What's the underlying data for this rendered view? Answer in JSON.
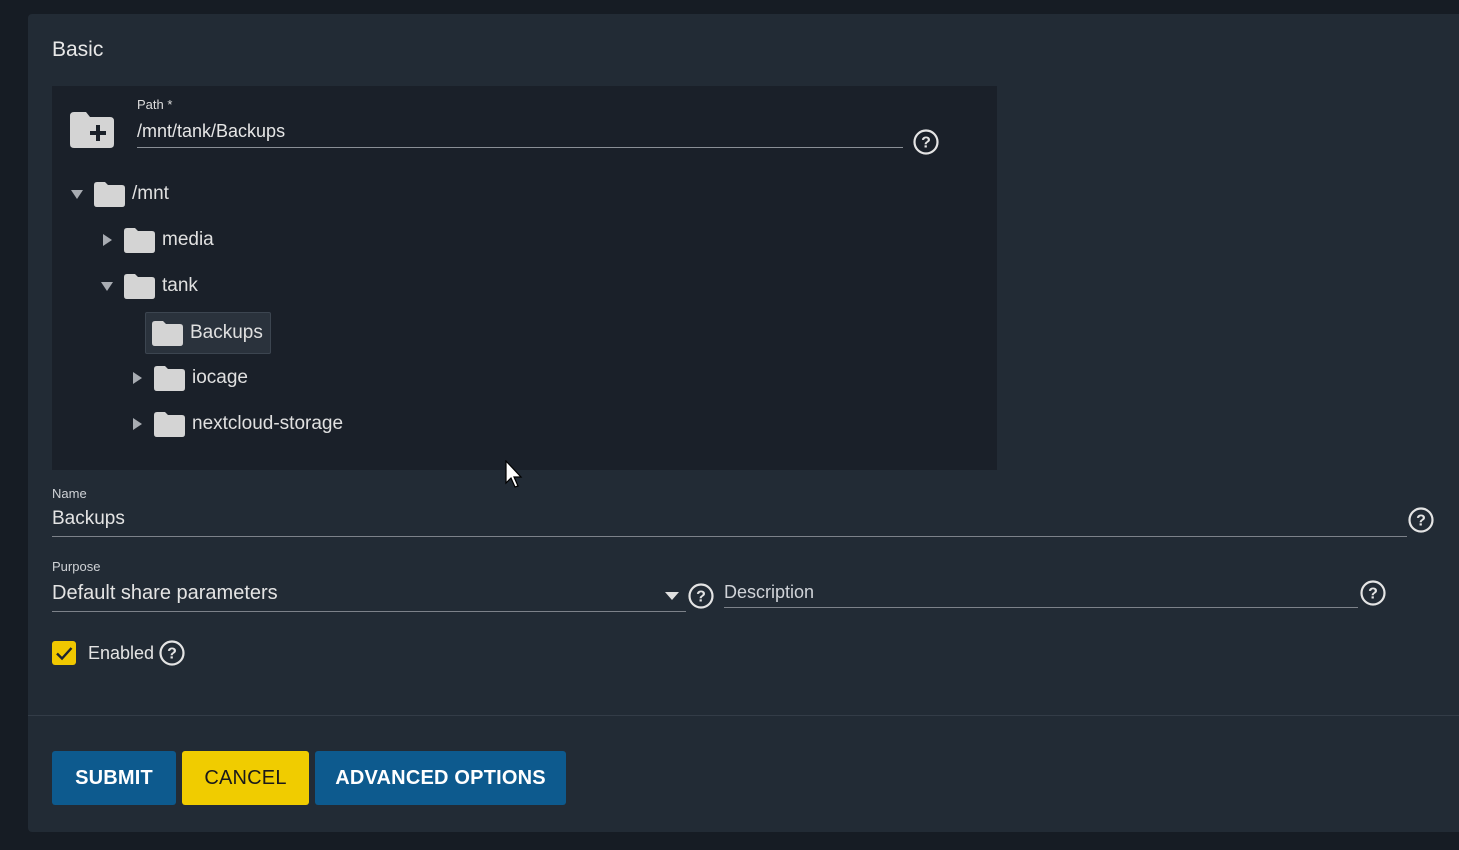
{
  "form": {
    "section_title": "Basic",
    "path": {
      "label": "Path *",
      "value": "/mnt/tank/Backups"
    },
    "tree": {
      "root": "/mnt",
      "media": "media",
      "tank": "tank",
      "backups": "Backups",
      "iocage": "iocage",
      "nextcloud": "nextcloud-storage"
    },
    "name": {
      "label": "Name",
      "value": "Backups"
    },
    "purpose": {
      "label": "Purpose",
      "value": "Default share parameters"
    },
    "description": {
      "placeholder": "Description"
    },
    "enabled": {
      "label": "Enabled",
      "checked": true
    },
    "buttons": {
      "submit": "SUBMIT",
      "cancel": "CANCEL",
      "advanced": "ADVANCED OPTIONS"
    }
  },
  "colors": {
    "background": "#161c24",
    "card": "#222b35",
    "explorer": "#1a2029",
    "primary_button": "#0d5a8e",
    "accent_yellow": "#f0cc00"
  },
  "icons": [
    "folder-add-icon",
    "folder-icon",
    "help-icon",
    "expand-arrow-icon",
    "collapse-arrow-icon",
    "dropdown-caret-icon",
    "checkmark-icon",
    "mouse-cursor-icon"
  ]
}
